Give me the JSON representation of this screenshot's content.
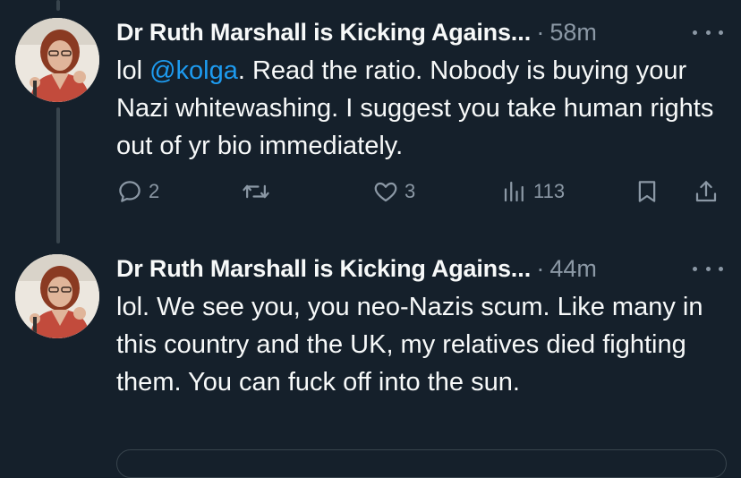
{
  "tweets": [
    {
      "author": "Dr Ruth Marshall is Kicking Agains",
      "ellipsis": "...",
      "separator": "·",
      "time": "58m",
      "text_before": "lol ",
      "mention": "@kolga",
      "text_after": ". Read the ratio. Nobody is buying your Nazi whitewashing. I suggest you take human rights out of yr bio immediately.",
      "reply_count": "2",
      "retweet_count": "",
      "like_count": "3",
      "view_count": "113"
    },
    {
      "author": "Dr Ruth Marshall is Kicking Agains",
      "ellipsis": "...",
      "separator": "·",
      "time": "44m",
      "text": "lol. We see you, you neo-Nazis scum. Like many in this country and the UK, my relatives died fighting them. You can fuck off into the sun."
    }
  ],
  "icons": {
    "reply": "reply-icon",
    "retweet": "retweet-icon",
    "like": "heart-icon",
    "views": "views-icon",
    "bookmark": "bookmark-icon",
    "share": "share-icon",
    "more": "more-icon"
  },
  "colors": {
    "background": "#15202b",
    "text": "#f7f9f9",
    "secondary": "#8b98a5",
    "link": "#1d9bf0",
    "thread_line": "#38444d"
  }
}
